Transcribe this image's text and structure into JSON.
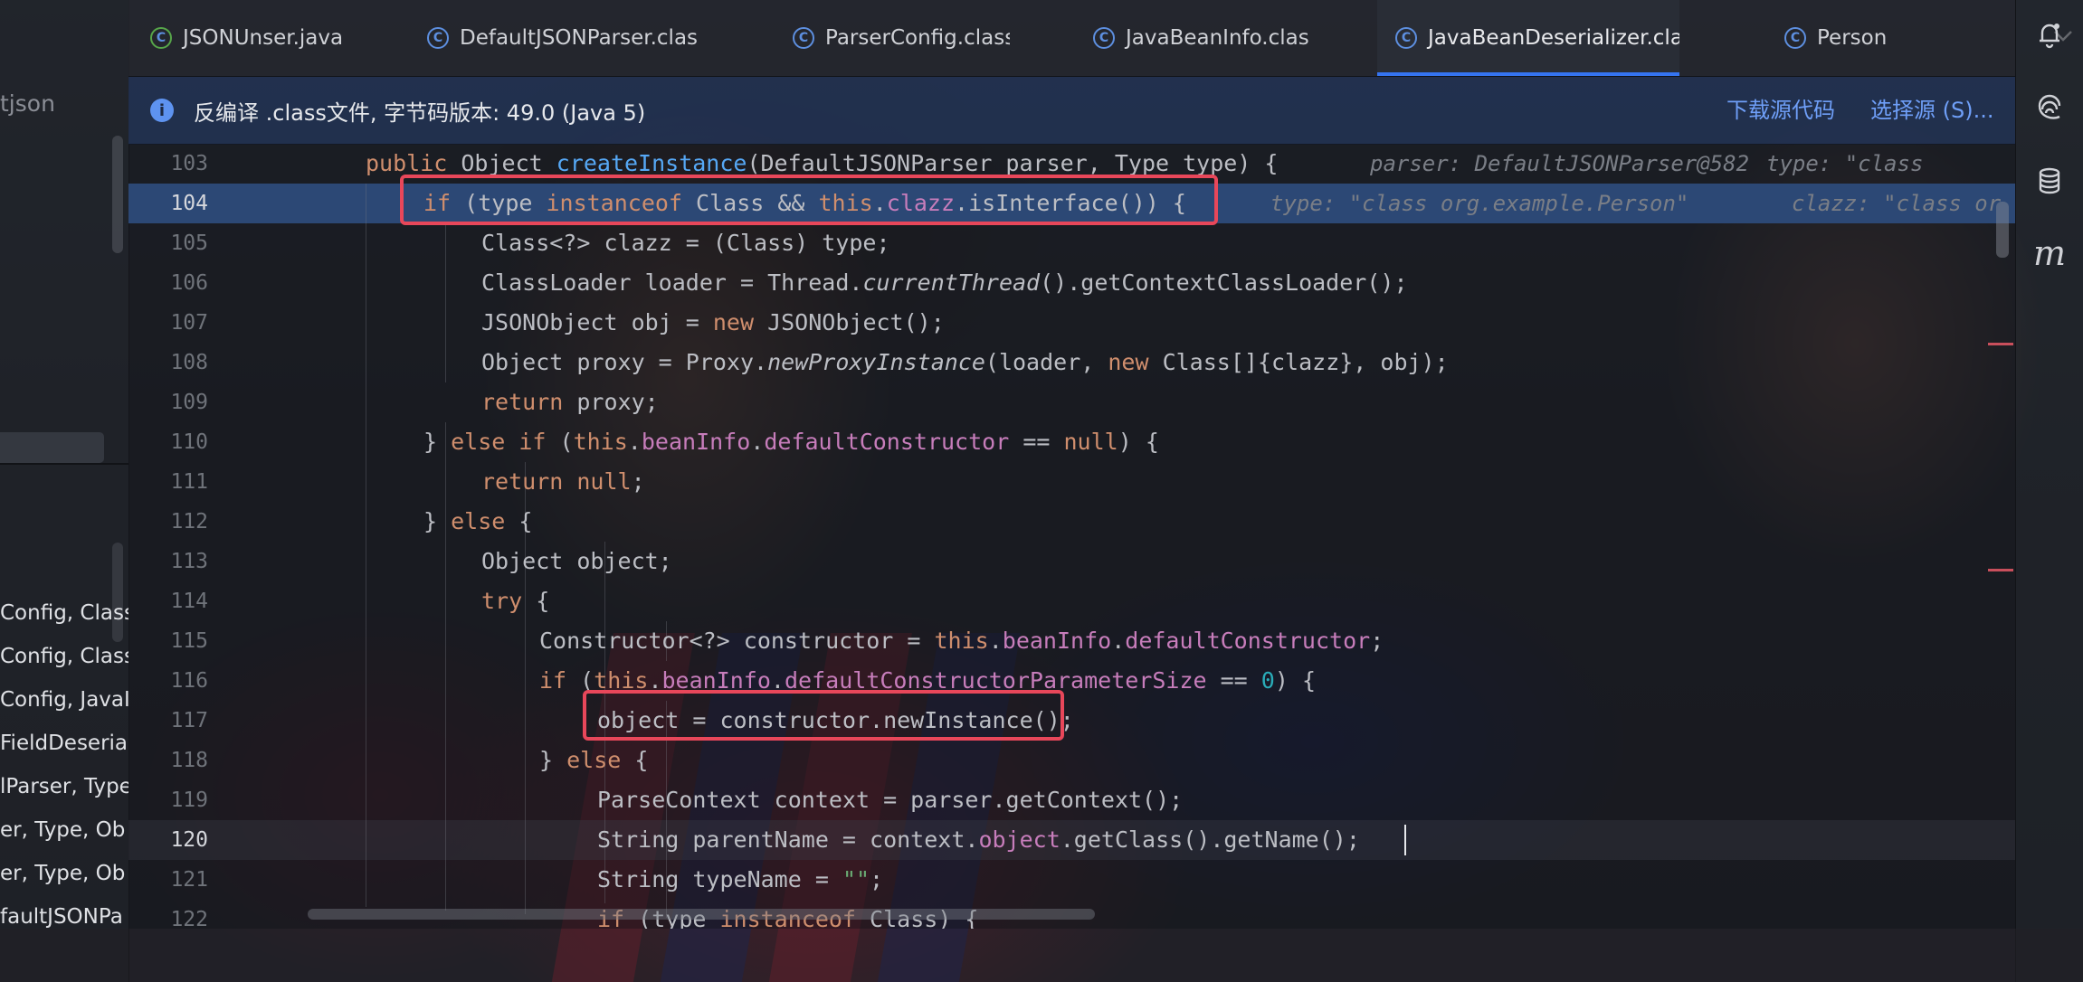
{
  "project_panel": {
    "top_label": "tjson",
    "items": [
      "Config, Class",
      "Config, Class",
      "Config, JavaI",
      "FieldDeseria",
      "lParser, Type",
      "er, Type, Ob",
      "er, Type, Ob",
      "faultJSONPa"
    ]
  },
  "tabs": [
    {
      "label": "JSONUnser.java",
      "icon": "java-class-icon"
    },
    {
      "label": "DefaultJSONParser.class",
      "icon": "class-icon"
    },
    {
      "label": "ParserConfig.class",
      "icon": "class-icon"
    },
    {
      "label": "JavaBeanInfo.class",
      "icon": "class-icon"
    },
    {
      "label": "JavaBeanDeserializer.class",
      "icon": "class-icon",
      "active": true,
      "close": "×"
    },
    {
      "label": "Person",
      "icon": "class-icon"
    }
  ],
  "tab_overflow": {
    "more": "⋮"
  },
  "banner": {
    "message": "反编译 .class文件, 字节码版本: 49.0 (Java 5)",
    "download_link": "下载源代码",
    "choose_link": "选择源 (S)..."
  },
  "editor": {
    "line_numbers": [
      "103",
      "104",
      "105",
      "106",
      "107",
      "108",
      "109",
      "110",
      "111",
      "112",
      "113",
      "114",
      "115",
      "116",
      "117",
      "118",
      "119",
      "120",
      "121",
      "122"
    ],
    "hints": {
      "line103_parser": "parser: DefaultJSONParser@582",
      "line103_type": "type: \"class",
      "line104_type": "type: \"class org.example.Person\"",
      "line104_clazz": "clazz: \"class or"
    },
    "current_line": "104",
    "caret_line": "120"
  },
  "colors": {
    "keyword": "#cf8e6d",
    "method": "#56a8f5",
    "field": "#c77dbb",
    "number": "#2aacb8",
    "string": "#6aab73",
    "highlight_box": "#e8475a",
    "current_line": "#2c4875",
    "accent": "#3574f0"
  },
  "right_toolbar": [
    "notifications-icon",
    "ai-assistant-icon",
    "database-icon",
    "maven-icon"
  ]
}
